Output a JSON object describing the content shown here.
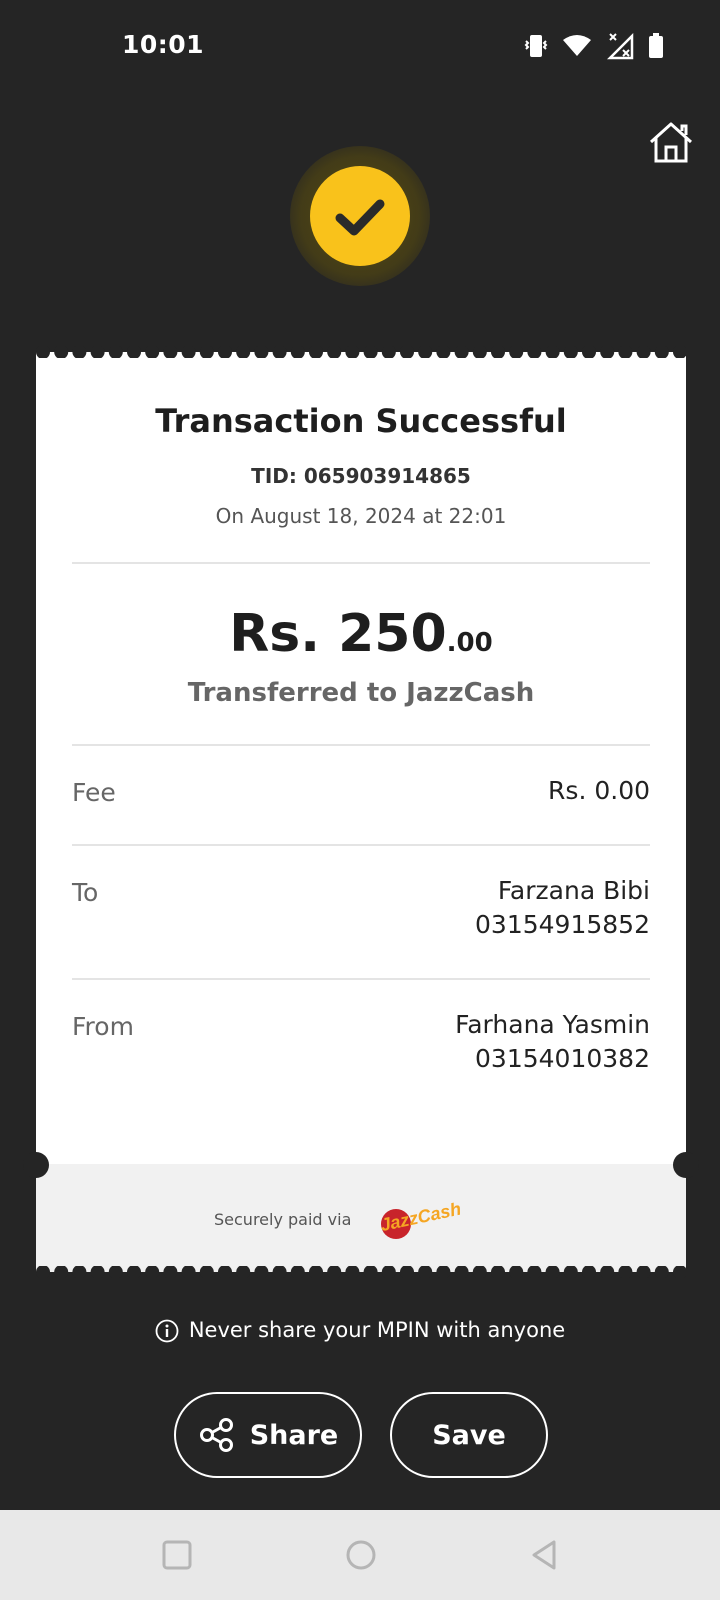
{
  "status_bar": {
    "time": "10:01",
    "icons": [
      "vibrate-icon",
      "wifi-icon",
      "signal-off-icon",
      "battery-icon"
    ]
  },
  "header": {
    "home_icon": "home-icon",
    "success_icon": "check-icon"
  },
  "receipt": {
    "title": "Transaction Successful",
    "tid": "TID: 065903914865",
    "date": "On August 18, 2024 at 22:01",
    "amount_main": "Rs. 250",
    "amount_decimal": ".00",
    "transferred_to": "Transferred to JazzCash",
    "fee": {
      "label": "Fee",
      "value": "Rs. 0.00"
    },
    "to": {
      "label": "To",
      "name": "Farzana Bibi",
      "number": "03154915852"
    },
    "from": {
      "label": "From",
      "name": "Farhana Yasmin",
      "number": "03154010382"
    },
    "footer": {
      "secure_text": "Securely paid via",
      "logo": "JazzCash"
    }
  },
  "warning": {
    "icon": "info-icon",
    "text": "Never share your MPIN with anyone"
  },
  "actions": {
    "share_label": "Share",
    "save_label": "Save"
  },
  "nav_bar": {
    "icons": [
      "recents-icon",
      "home-circle-icon",
      "back-icon"
    ]
  },
  "colors": {
    "background": "#252525",
    "accent": "#f9c21b",
    "card": "#ffffff",
    "footer": "#f1f1f1"
  }
}
